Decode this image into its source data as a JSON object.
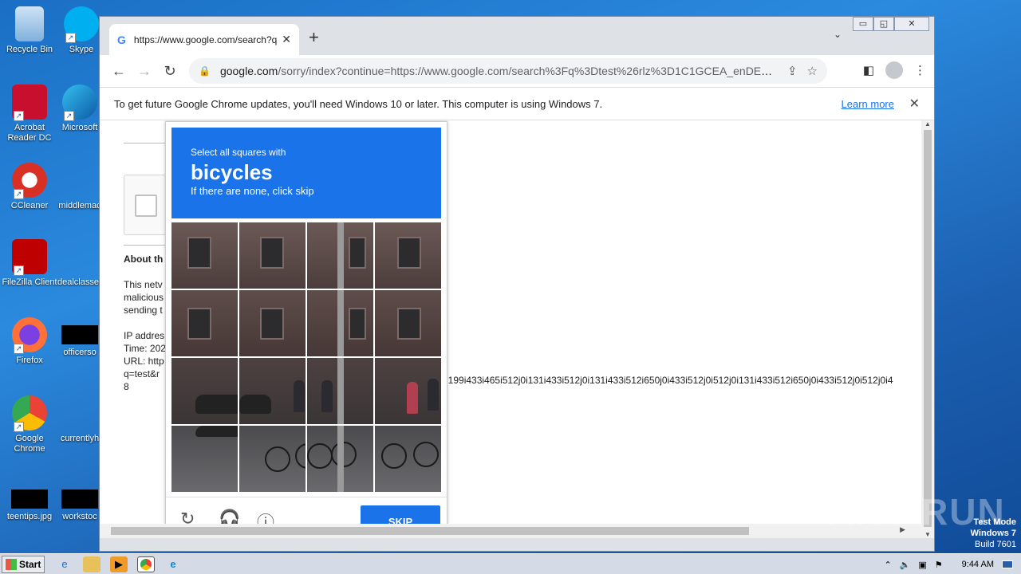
{
  "desktop": {
    "icons": [
      {
        "label": "Recycle Bin",
        "x": 0,
        "y": 6,
        "color": "#5aa0d8"
      },
      {
        "label": "Skype",
        "color": "#00aff0"
      },
      {
        "label": "Acrobat Reader DC",
        "color": "#c8102e"
      },
      {
        "label": "Microsoft",
        "color": "#0a8fd6"
      },
      {
        "label": "CCleaner",
        "color": "#d93025"
      },
      {
        "label": "middlemac"
      },
      {
        "label": "FileZilla Client",
        "color": "#c8102e"
      },
      {
        "label": "dealclasses"
      },
      {
        "label": "Firefox",
        "color": "#ff7139"
      },
      {
        "label": "officerso"
      },
      {
        "label": "Google Chrome",
        "color": "#34a853"
      },
      {
        "label": "currentlyh"
      },
      {
        "label": "teentips.jpg"
      },
      {
        "label": "workstoc"
      }
    ]
  },
  "browser": {
    "tab_title": "https://www.google.com/search?q=",
    "tab_icon": "G",
    "url_host": "google.com",
    "url_rest": "/sorry/index?continue=https://www.google.com/search%3Fq%3Dtest%26rlz%3D1C1GCEA_enDE106…",
    "infobar_text": "To get future Google Chrome updates, you'll need Windows 10 or later. This computer is using Windows 7.",
    "infobar_link": "Learn more"
  },
  "page": {
    "about": "About th",
    "p1": "This netv",
    "p2": "malicious",
    "p3": "sending t",
    "ip": "IP addres",
    "time": "Time: 202",
    "url": "URL: http",
    "q": "q=test&r",
    "n": "8",
    "longline": "i199i433i465i512j0i131i433i512j0i131i433i512i650j0i433i512j0i512j0i131i433i512i650j0i433i512j0i512j0i4"
  },
  "captcha": {
    "line1": "Select all squares with",
    "target": "bicycles",
    "line3": "If there are none, click skip",
    "skip": "SKIP"
  },
  "taskbar": {
    "start": "Start",
    "clock": "9:44 AM"
  },
  "watermark": {
    "l1": "Test Mode",
    "l2": "Windows 7",
    "l3": "Build 7601",
    "brand": "ANY RUN"
  }
}
